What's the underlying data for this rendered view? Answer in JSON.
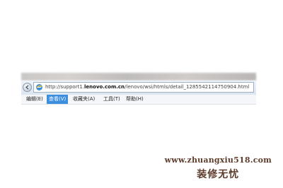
{
  "browser": {
    "address": {
      "scheme": "http://",
      "host_pre": "support1.",
      "host_bold": "lenovo.com.cn",
      "path": "/lenovo/wsi/htmls/detail_1285542114750904.html"
    },
    "menu": [
      {
        "label": "编辑(E)",
        "active": false
      },
      {
        "label": "查看(V)",
        "active": true
      },
      {
        "label": "收藏夹(A)",
        "active": false
      },
      {
        "label": "工具(T)",
        "active": false
      },
      {
        "label": "帮助(H)",
        "active": false
      }
    ],
    "colors": {
      "menu_highlight": "#3c8ede",
      "address_bar_bg": "#dce6f1"
    }
  },
  "watermark": {
    "url": "www.zhuangxiu518.com",
    "name": "装修无忧"
  }
}
